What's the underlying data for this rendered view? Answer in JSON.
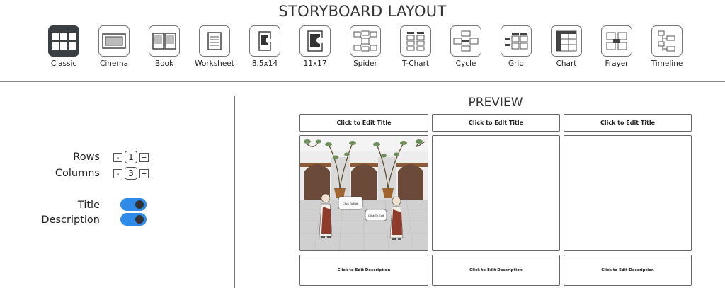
{
  "header": {
    "title": "STORYBOARD LAYOUT"
  },
  "layouts": [
    {
      "label": "Classic",
      "icon": "classic-layout-icon",
      "active": true
    },
    {
      "label": "Cinema",
      "icon": "cinema-layout-icon"
    },
    {
      "label": "Book",
      "icon": "book-layout-icon"
    },
    {
      "label": "Worksheet",
      "icon": "worksheet-layout-icon"
    },
    {
      "label": "8.5x14",
      "icon": "page-8-5x14-icon"
    },
    {
      "label": "11x17",
      "icon": "page-11x17-icon"
    },
    {
      "label": "Spider",
      "icon": "spider-layout-icon"
    },
    {
      "label": "T-Chart",
      "icon": "t-chart-layout-icon"
    },
    {
      "label": "Cycle",
      "icon": "cycle-layout-icon"
    },
    {
      "label": "Grid",
      "icon": "grid-layout-icon"
    },
    {
      "label": "Chart",
      "icon": "chart-layout-icon"
    },
    {
      "label": "Frayer",
      "icon": "frayer-layout-icon"
    },
    {
      "label": "Timeline",
      "icon": "timeline-layout-icon"
    }
  ],
  "controls": {
    "rows": {
      "label": "Rows",
      "value": "1",
      "minus": "-",
      "plus": "+"
    },
    "columns": {
      "label": "Columns",
      "value": "3",
      "minus": "-",
      "plus": "+"
    },
    "title_toggle": {
      "label": "Title",
      "on": true
    },
    "description_toggle": {
      "label": "Description",
      "on": true
    }
  },
  "preview": {
    "title": "PREVIEW",
    "cells": [
      {
        "title": "Click to Edit Title",
        "description": "Click to Edit Description",
        "has_scene": true
      },
      {
        "title": "Click to Edit Title",
        "description": "Click to Edit Description",
        "has_scene": false
      },
      {
        "title": "Click to Edit Title",
        "description": "Click to Edit Description",
        "has_scene": false
      }
    ],
    "scene": {
      "bubble1": "Click To Edit",
      "bubble2": "Click To Edit"
    }
  },
  "colors": {
    "toggle_on": "#2f8ae8",
    "active_icon_bg": "#3a3f44"
  }
}
